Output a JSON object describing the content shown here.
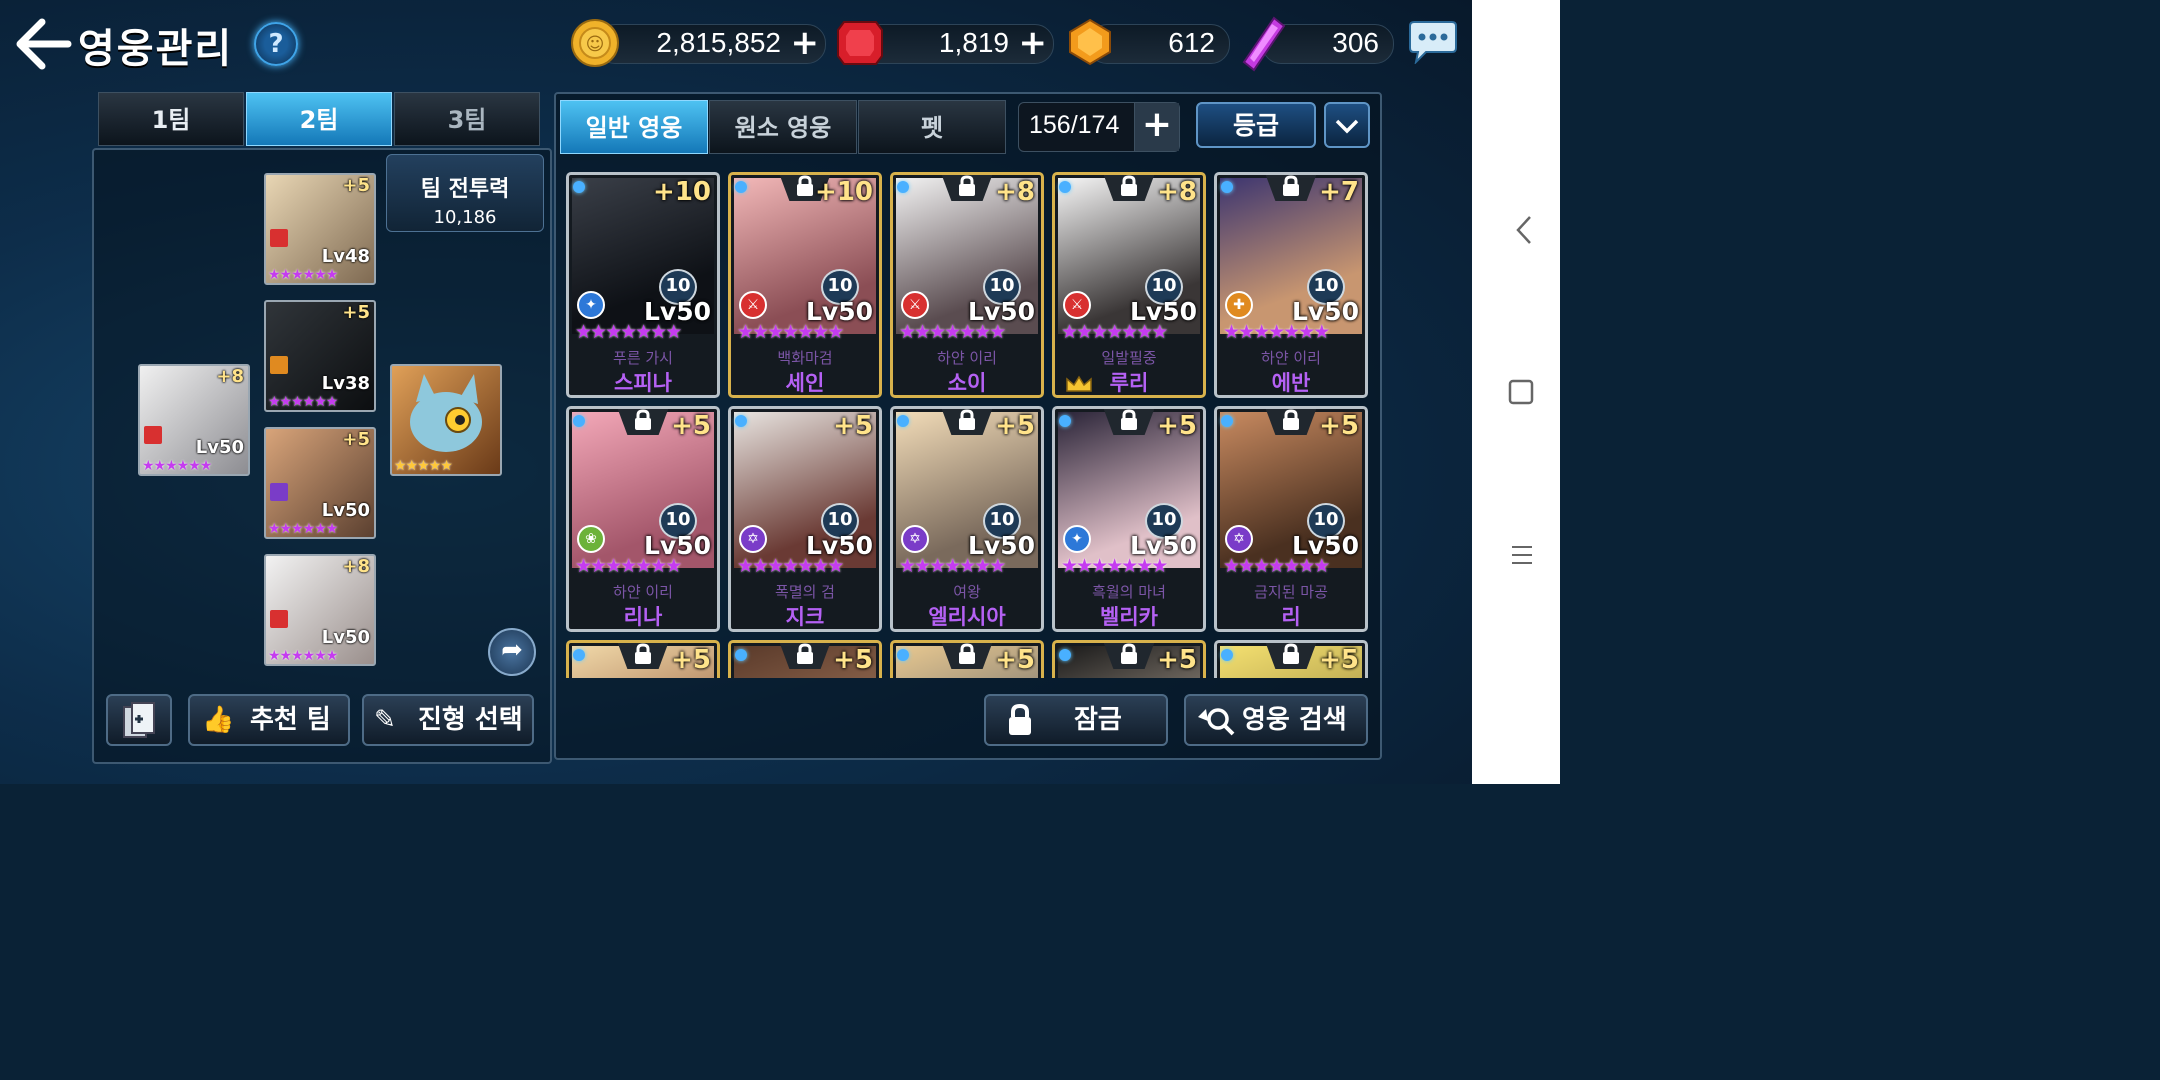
{
  "header": {
    "title": "영웅관리",
    "help": "?"
  },
  "resources": [
    {
      "name": "gold",
      "value": "2,815,852",
      "has_plus": true,
      "icon": "gold-coin-icon",
      "color": "#f0b22a"
    },
    {
      "name": "ruby",
      "value": "1,819",
      "has_plus": true,
      "icon": "red-gem-icon",
      "color": "#d81e2a"
    },
    {
      "name": "orange-crystal",
      "value": "612",
      "has_plus": false,
      "icon": "orange-crystal-icon",
      "color": "#f39b1c"
    },
    {
      "name": "purple-crystal",
      "value": "306",
      "has_plus": false,
      "icon": "purple-crystal-icon",
      "color": "#c43ae0"
    }
  ],
  "team_tabs": [
    "1팀",
    "2팀",
    "3팀"
  ],
  "active_team_tab": 1,
  "team_power": {
    "label": "팀 전투력",
    "value": "10,186"
  },
  "team_slots": [
    {
      "plus": "+5",
      "lv": "Lv48",
      "elem": "sword",
      "stars": 6
    },
    {
      "plus": "+5",
      "lv": "Lv38",
      "elem": "shield",
      "stars": 6
    },
    {
      "plus": "+8",
      "lv": "Lv50",
      "elem": "sword",
      "stars": 6
    },
    {
      "plus": "+5",
      "lv": "Lv50",
      "elem": "magic",
      "stars": 6
    },
    {
      "plus": "+8",
      "lv": "Lv50",
      "elem": "sword",
      "stars": 6
    },
    {
      "plus": "",
      "lv": "",
      "elem": "",
      "stars": 5
    }
  ],
  "left_buttons": {
    "recommend": "추천 팀",
    "formation": "진형 선택"
  },
  "hero_tabs": [
    "일반 영웅",
    "원소 영웅",
    "펫"
  ],
  "active_hero_tab": 0,
  "hero_count": "156/174",
  "sort_label": "등급",
  "heroes": [
    {
      "plus": "+10",
      "badge": "10",
      "lv": "Lv50",
      "title": "푸른 가시",
      "name": "스피나",
      "locked": false,
      "gold": false,
      "elem": "wand"
    },
    {
      "plus": "+10",
      "badge": "10",
      "lv": "Lv50",
      "title": "백화마검",
      "name": "세인",
      "locked": true,
      "gold": true,
      "elem": "sword"
    },
    {
      "plus": "+8",
      "badge": "10",
      "lv": "Lv50",
      "title": "하얀 이리",
      "name": "소이",
      "locked": true,
      "gold": true,
      "elem": "sword"
    },
    {
      "plus": "+8",
      "badge": "10",
      "lv": "Lv50",
      "title": "일발필중",
      "name": "루리",
      "locked": true,
      "gold": true,
      "elem": "sword",
      "crown": true
    },
    {
      "plus": "+7",
      "badge": "10",
      "lv": "Lv50",
      "title": "하얀 이리",
      "name": "에반",
      "locked": true,
      "gold": false,
      "elem": "shield"
    },
    {
      "plus": "+5",
      "badge": "10",
      "lv": "Lv50",
      "title": "하얀 이리",
      "name": "리나",
      "locked": true,
      "gold": false,
      "elem": "heal"
    },
    {
      "plus": "+5",
      "badge": "10",
      "lv": "Lv50",
      "title": "폭멸의 검",
      "name": "지크",
      "locked": false,
      "gold": false,
      "elem": "magic"
    },
    {
      "plus": "+5",
      "badge": "10",
      "lv": "Lv50",
      "title": "여왕",
      "name": "엘리시아",
      "locked": true,
      "gold": false,
      "elem": "magic"
    },
    {
      "plus": "+5",
      "badge": "10",
      "lv": "Lv50",
      "title": "흑월의 마녀",
      "name": "벨리카",
      "locked": true,
      "gold": false,
      "elem": "wand"
    },
    {
      "plus": "+5",
      "badge": "10",
      "lv": "Lv50",
      "title": "금지된 마공",
      "name": "리",
      "locked": true,
      "gold": false,
      "elem": "magic"
    },
    {
      "plus": "+5",
      "locked": true,
      "gold": true
    },
    {
      "plus": "+5",
      "locked": true,
      "gold": true
    },
    {
      "plus": "+5",
      "locked": true,
      "gold": true
    },
    {
      "plus": "+5",
      "locked": true,
      "gold": true
    },
    {
      "plus": "+5",
      "locked": true,
      "gold": false
    }
  ],
  "right_buttons": {
    "lock": "잠금",
    "search": "영웅 검색"
  },
  "elem_colors": {
    "sword": "#d83030",
    "shield": "#e08a20",
    "wand": "#2d78d8",
    "magic": "#7a3cc8",
    "heal": "#6cb23a"
  }
}
